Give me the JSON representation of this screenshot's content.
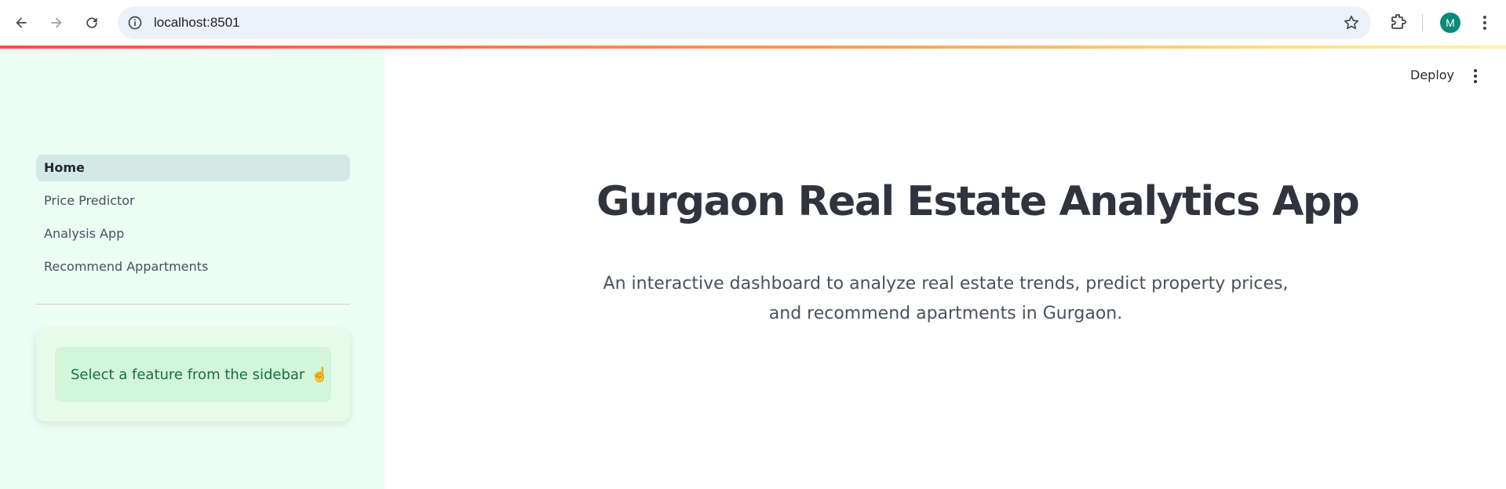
{
  "browser": {
    "url": "localhost:8501",
    "avatar_letter": "M",
    "icons": [
      "back-arrow-icon",
      "forward-arrow-icon",
      "reload-icon",
      "info-icon",
      "star-icon",
      "extensions-icon",
      "kebab-menu-icon"
    ]
  },
  "sidebar": {
    "items": [
      {
        "label": "Home",
        "active": true
      },
      {
        "label": "Price Predictor",
        "active": false
      },
      {
        "label": "Analysis App",
        "active": false
      },
      {
        "label": "Recommend Appartments",
        "active": false
      }
    ],
    "info_text": "Select a feature from the sidebar",
    "info_emoji": "☝️"
  },
  "header": {
    "deploy_label": "Deploy"
  },
  "main": {
    "title": "Gurgaon Real Estate Analytics App",
    "subtitle": "An interactive dashboard to analyze real estate trends, predict property prices, and recommend apartments in Gurgaon."
  },
  "colors": {
    "sidebar_bg": "#ecfdf3",
    "active_item_bg": "#d3e9e6",
    "info_bg": "#d2f5dc",
    "info_text": "#16713b",
    "title_text": "#31333f"
  }
}
